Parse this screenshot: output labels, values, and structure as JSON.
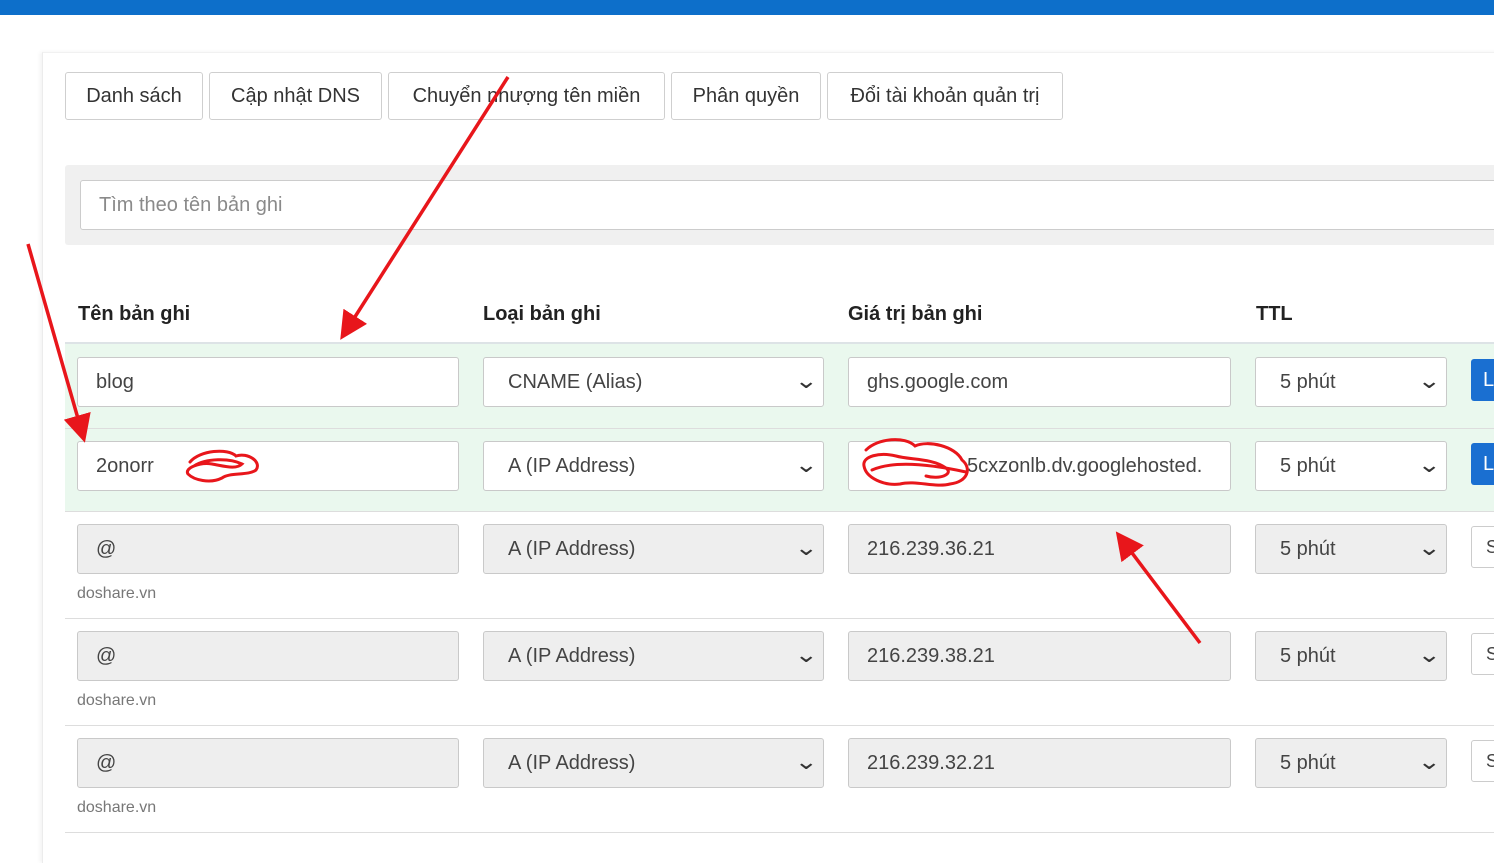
{
  "tabs": [
    {
      "label": "Danh sách"
    },
    {
      "label": "Cập nhật DNS"
    },
    {
      "label": "Chuyển nhượng tên miền"
    },
    {
      "label": "Phân quyền"
    },
    {
      "label": "Đổi tài khoản quản trị"
    }
  ],
  "search": {
    "placeholder": "Tìm theo tên bản ghi"
  },
  "table": {
    "headers": {
      "name": "Tên bản ghi",
      "type": "Loại bản ghi",
      "value": "Giá trị bản ghi",
      "ttl": "TTL"
    },
    "rows": [
      {
        "name": "blog",
        "type": "CNAME (Alias)",
        "value": "ghs.google.com",
        "ttl": "5 phút",
        "action": "L"
      },
      {
        "name": "2onorr",
        "type": "A (IP Address)",
        "value": "5cxzonlb.dv.googlehosted.",
        "ttl": "5 phút",
        "action": "L"
      },
      {
        "name": "@",
        "type": "A (IP Address)",
        "value": "216.239.36.21",
        "ttl": "5 phút",
        "domain": "doshare.vn",
        "action": "S"
      },
      {
        "name": "@",
        "type": "A (IP Address)",
        "value": "216.239.38.21",
        "ttl": "5 phút",
        "domain": "doshare.vn",
        "action": "S"
      },
      {
        "name": "@",
        "type": "A (IP Address)",
        "value": "216.239.32.21",
        "ttl": "5 phút",
        "domain": "doshare.vn",
        "action": "S"
      }
    ]
  },
  "icons": {
    "select_arrow": "chevron-down-icon"
  },
  "colors": {
    "topbar": "#0d6fca",
    "highlight_row": "#eaf8ee",
    "primary_button": "#1a6fd1",
    "annotation": "#e8161b"
  }
}
